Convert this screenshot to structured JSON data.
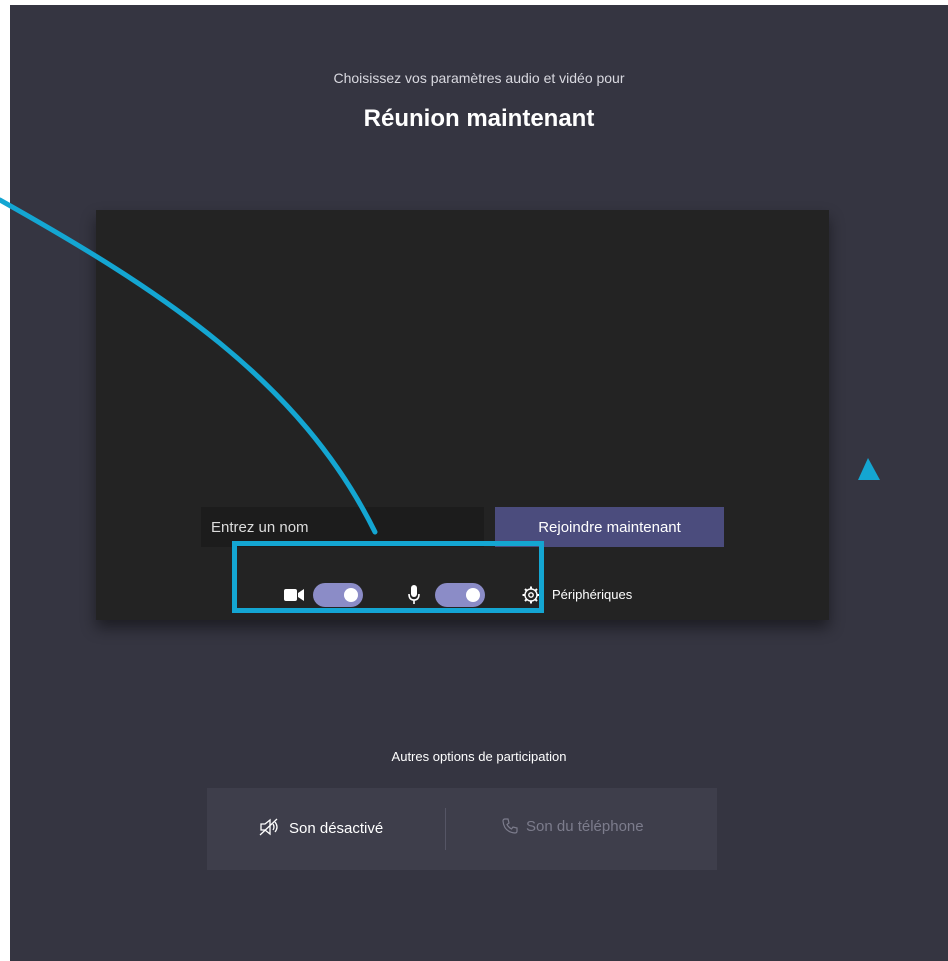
{
  "header": {
    "subtitle": "Choisissez vos paramètres audio et vidéo pour",
    "title": "Réunion maintenant"
  },
  "preview": {
    "name_placeholder": "Entrez un nom",
    "join_label": "Rejoindre maintenant",
    "camera_on": true,
    "microphone_on": true,
    "devices_label": "Périphériques"
  },
  "other_options": {
    "title": "Autres options de participation",
    "mute_label": "Son désactivé",
    "phone_label": "Son du téléphone"
  },
  "colors": {
    "background": "#353541",
    "preview_bg": "#232323",
    "accent": "#4b4c7d",
    "toggle_on": "#8b8cc7",
    "annotation": "#14a6d2"
  }
}
